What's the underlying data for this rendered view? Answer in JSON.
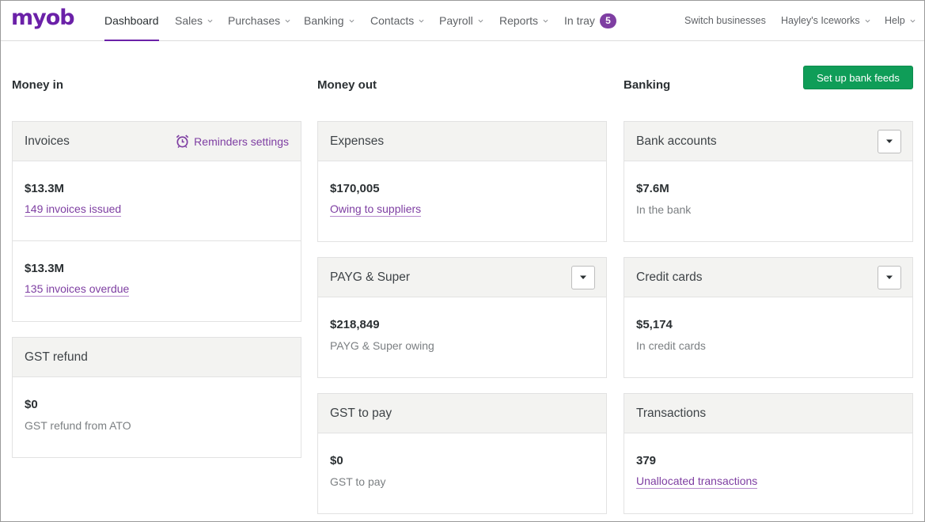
{
  "brand": {
    "logo_text": "myob",
    "accent": "#6b21a8",
    "green": "#0f9d58"
  },
  "nav": {
    "items": [
      {
        "label": "Dashboard",
        "active": true
      },
      {
        "label": "Sales",
        "dropdown": true
      },
      {
        "label": "Purchases",
        "dropdown": true
      },
      {
        "label": "Banking",
        "dropdown": true
      },
      {
        "label": "Contacts",
        "dropdown": true
      },
      {
        "label": "Payroll",
        "dropdown": true
      },
      {
        "label": "Reports",
        "dropdown": true
      },
      {
        "label": "In tray",
        "badge": "5"
      }
    ],
    "right": {
      "switch_label": "Switch businesses",
      "business_label": "Hayley's Iceworks",
      "help_label": "Help"
    }
  },
  "columns": {
    "money_in": "Money in",
    "money_out": "Money out",
    "banking": "Banking"
  },
  "setup_bank_feeds_label": "Set up bank feeds",
  "cards": {
    "invoices": {
      "title": "Invoices",
      "reminders_label": "Reminders settings",
      "rows": [
        {
          "amount": "$13.3M",
          "link": "149 invoices issued"
        },
        {
          "amount": "$13.3M",
          "link": "135 invoices overdue"
        }
      ]
    },
    "gst_refund": {
      "title": "GST refund",
      "amount": "$0",
      "sub": "GST refund from ATO"
    },
    "expenses": {
      "title": "Expenses",
      "amount": "$170,005",
      "link": "Owing to suppliers"
    },
    "payg": {
      "title": "PAYG & Super",
      "amount": "$218,849",
      "sub": "PAYG & Super owing"
    },
    "gst_pay": {
      "title": "GST to pay",
      "amount": "$0",
      "sub": "GST to pay"
    },
    "bank_accounts": {
      "title": "Bank accounts",
      "amount": "$7.6M",
      "sub": "In the bank"
    },
    "credit_cards": {
      "title": "Credit cards",
      "amount": "$5,174",
      "sub": "In credit cards"
    },
    "transactions": {
      "title": "Transactions",
      "amount": "379",
      "link": "Unallocated transactions"
    }
  }
}
